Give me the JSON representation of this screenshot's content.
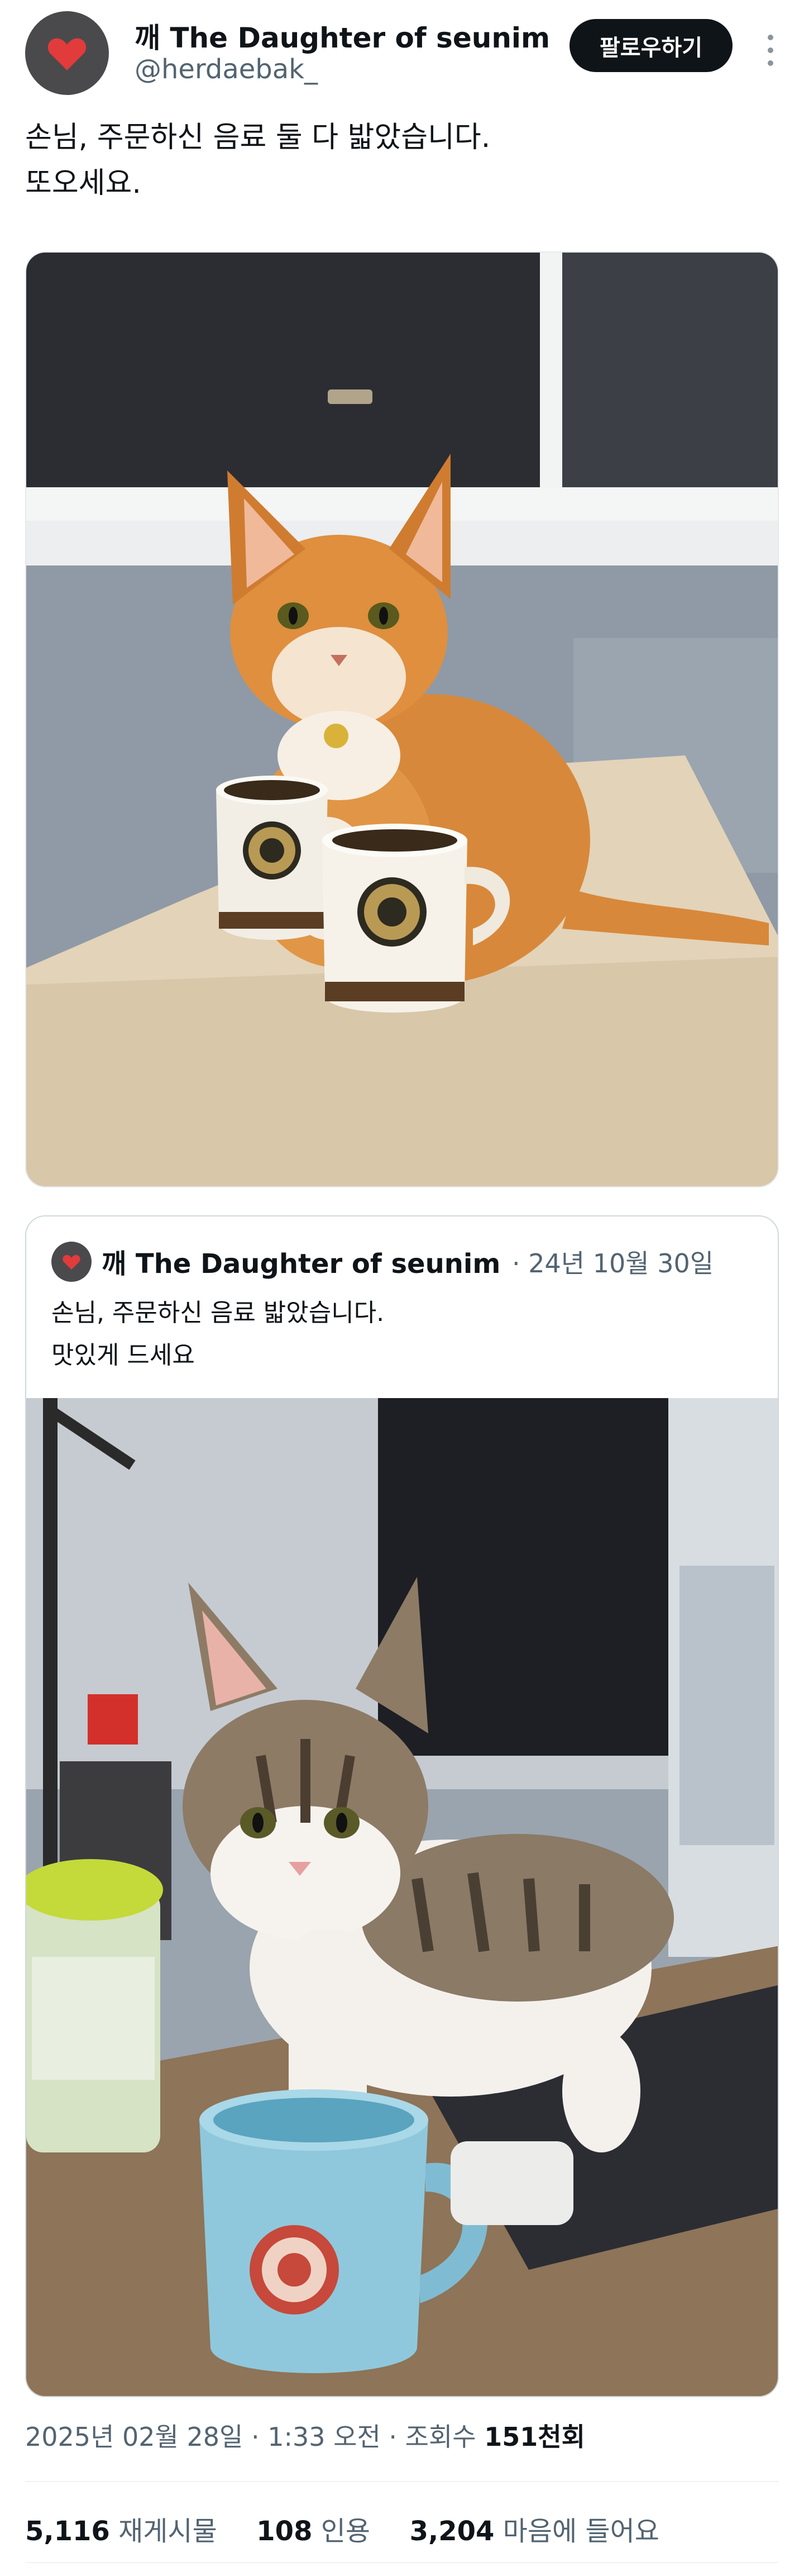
{
  "author": {
    "emoji": "깨",
    "name": "The Daughter of seunim",
    "handle": "@herdaebak_",
    "avatar_color": "#4a4a4c",
    "avatar_icon": "heart-icon"
  },
  "follow_label": "팔로우하기",
  "tweet": {
    "line1": "손님, 주문하신 음료 둘 다 밟았습니다.",
    "line2": "또오세요."
  },
  "quoted": {
    "emoji": "깨",
    "name": "The Daughter of seunim",
    "separator": "·",
    "date": "24년 10월 30일",
    "line1": "손님, 주문하신 음료 밟았습니다.",
    "line2": "맛있게 드세요"
  },
  "timestamp": {
    "date": "2025년 02월 28일",
    "sep1": "·",
    "time": "1:33 오전",
    "sep2": "·",
    "views_label": "조회수",
    "views_value": "151천회"
  },
  "stats": {
    "retweets_count": "5,116",
    "retweets_label": "재게시물",
    "quotes_count": "108",
    "quotes_label": "인용",
    "likes_count": "3,204",
    "likes_label": "마음에 들어요"
  },
  "colors": {
    "text": "#0f1419",
    "muted": "#536471",
    "border": "#cfd9de",
    "button_bg": "#0f1419"
  }
}
